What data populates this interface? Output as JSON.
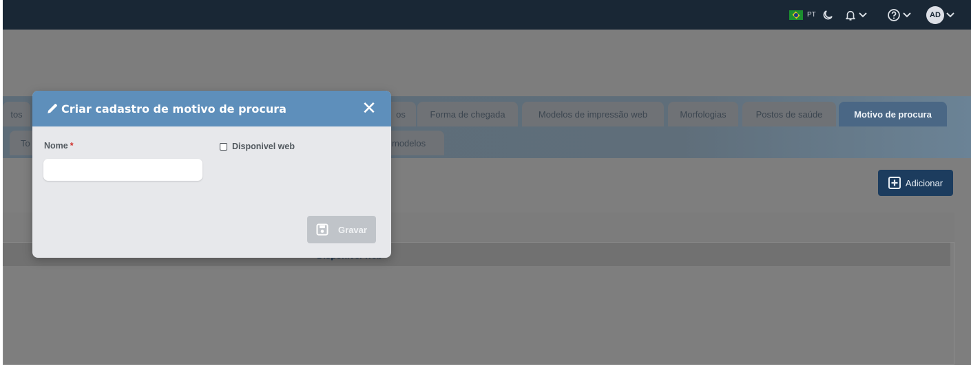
{
  "topbar": {
    "language": "PT",
    "avatar_initials": "AD",
    "icons": [
      "flag-brazil-icon",
      "moon-icon",
      "bell-icon",
      "help-circle-icon",
      "chevron-down-icon"
    ]
  },
  "tabs": {
    "row1": [
      "tos",
      "os",
      "Forma de chegada",
      "Modelos de impressão web",
      "Morfologias",
      "Postos de saúde",
      "Motivo de procura"
    ],
    "row2": [
      "To",
      "modelos"
    ],
    "active": "Motivo de procura"
  },
  "toolbar": {
    "add_label": "Adicionar"
  },
  "table": {
    "visible_cell": "Disponivel web"
  },
  "modal": {
    "title": "Criar cadastro de motivo de procura",
    "close_symbol": "✕",
    "field_nome_label": "Nome",
    "field_nome_required": "*",
    "field_nome_value": "",
    "checkbox_label": "Disponivel web",
    "checkbox_checked": false,
    "save_label": "Gravar"
  },
  "colors": {
    "topbar": "#192735",
    "modal_header": "#5e8fbb",
    "active_tab": "#4a6785",
    "add_button": "#1c3c5e",
    "required_mark": "#d0322e"
  }
}
